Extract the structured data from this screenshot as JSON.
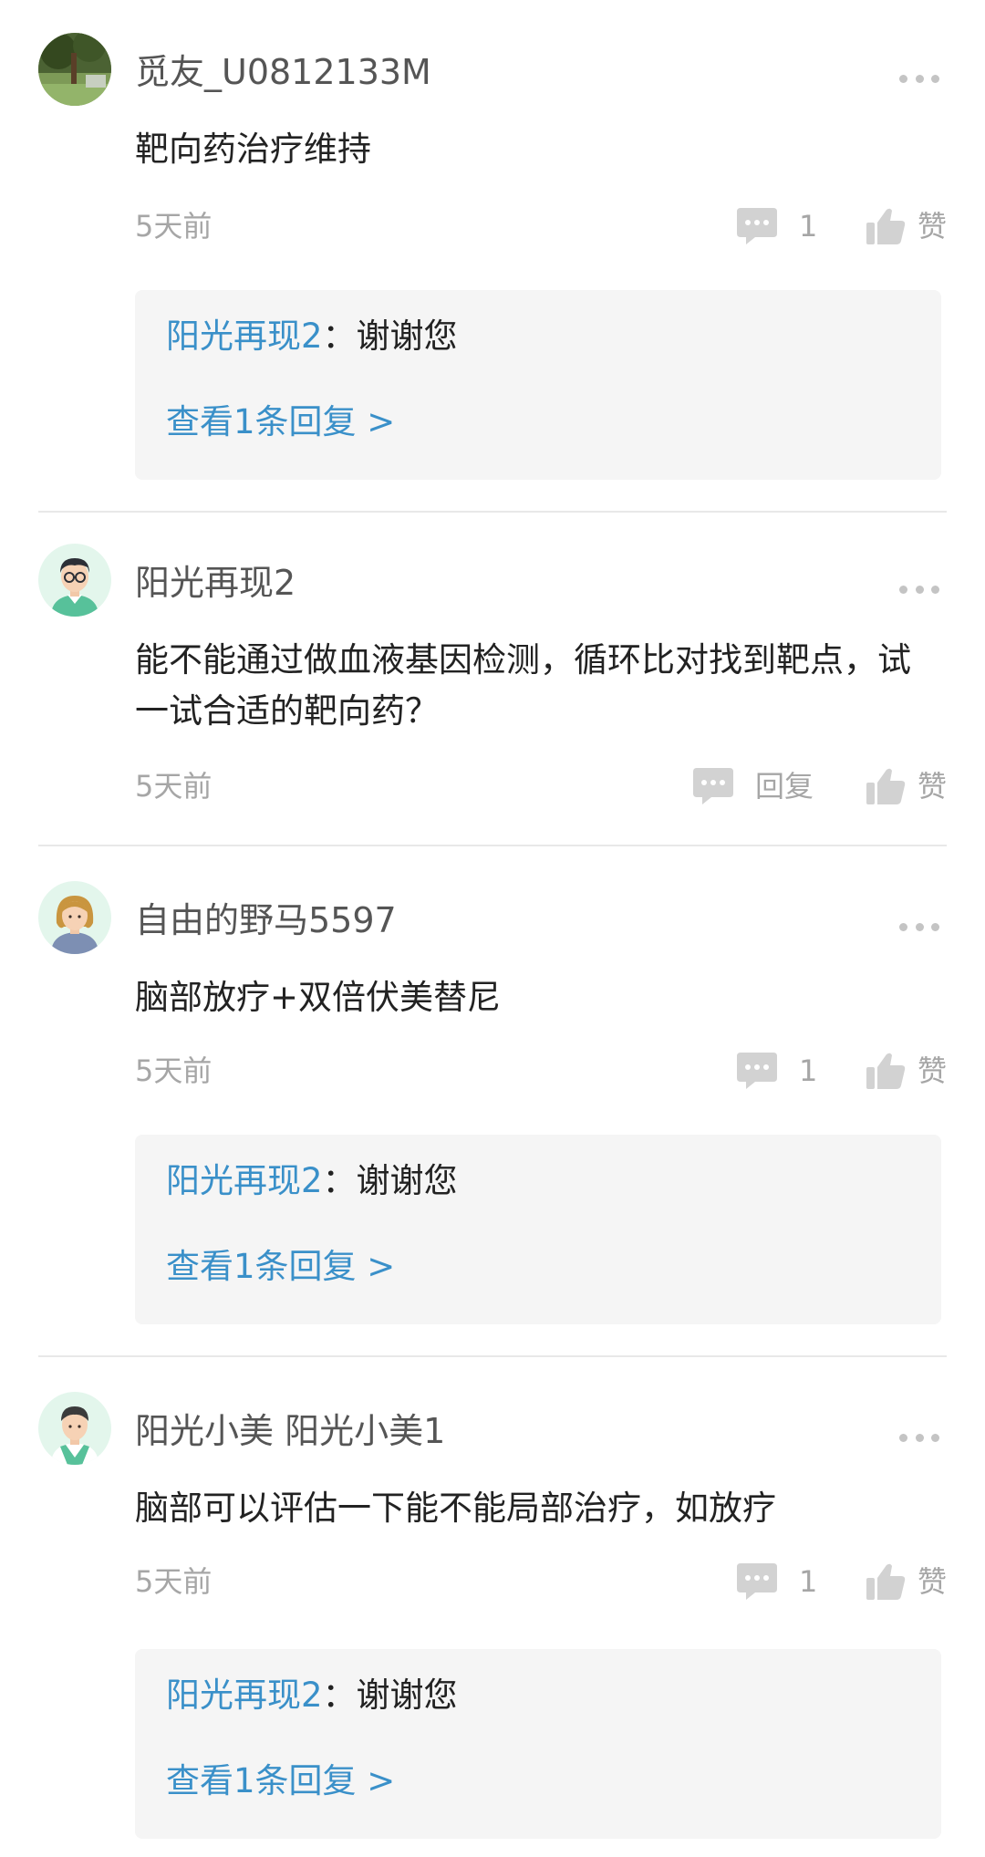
{
  "comments": [
    {
      "username": "觅友_U0812133M",
      "text": "靶向药治疗维持",
      "time": "5天前",
      "reply_count": "1",
      "like_label": "赞",
      "avatar_icon": "landscape-photo-avatar",
      "reply_preview": {
        "author": "阳光再现2",
        "colon": "：",
        "text": "谢谢您",
        "view_more": "查看1条回复 >"
      }
    },
    {
      "username": "阳光再现2",
      "text": "能不能通过做血液基因检测，循环比对找到靶点，试一试合适的靶向药？",
      "time": "5天前",
      "reply_count": "回复",
      "like_label": "赞",
      "avatar_icon": "man-glasses-avatar"
    },
    {
      "username": "自由的野马5597",
      "text": "脑部放疗+双倍伏美替尼",
      "time": "5天前",
      "reply_count": "1",
      "like_label": "赞",
      "avatar_icon": "woman-avatar",
      "reply_preview": {
        "author": "阳光再现2",
        "colon": "：",
        "text": "谢谢您",
        "view_more": "查看1条回复 >"
      }
    },
    {
      "username": "阳光小美 阳光小美1",
      "text": "脑部可以评估一下能不能局部治疗，如放疗",
      "time": "5天前",
      "reply_count": "1",
      "like_label": "赞",
      "avatar_icon": "doctor-avatar",
      "reply_preview": {
        "author": "阳光再现2",
        "colon": "：",
        "text": "谢谢您",
        "view_more": "查看1条回复 >"
      }
    }
  ],
  "colors": {
    "link": "#3a90c9",
    "muted": "#a6a6a6",
    "icon": "#d2d2d2",
    "reply_bg": "#f5f5f5"
  }
}
